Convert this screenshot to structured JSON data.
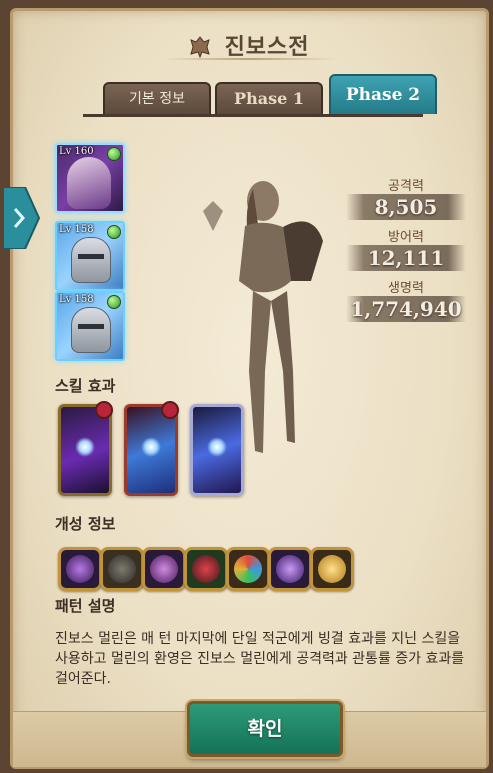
{
  "dialog": {
    "title": "진보스전"
  },
  "tabs": [
    {
      "label": "기본 정보",
      "active": false
    },
    {
      "label": "Phase 1",
      "active": false
    },
    {
      "label": "Phase 2",
      "active": true
    }
  ],
  "party": [
    {
      "level": "Lv 160"
    },
    {
      "level": "Lv 158"
    },
    {
      "level": "Lv 158"
    }
  ],
  "stats": {
    "attack_label": "공격력",
    "attack_value": "8,505",
    "defense_label": "방어력",
    "defense_value": "12,111",
    "hp_label": "생명력",
    "hp_value": "1,774,940"
  },
  "sections": {
    "skill_title": "스킬 효과",
    "trait_title": "개성 정보",
    "pattern_title": "패턴 설명"
  },
  "pattern_description": "진보스 멀린은 매 턴 마지막에 단일 적군에게 빙결 효과를 지닌 스킬을 사용하고 멀린의 환영은 진보스 멀린에게 공격력과 관통률 증가 효과를 걸어준다.",
  "confirm_button": "확인",
  "colors": {
    "active_tab": "#2f8f9d",
    "confirm": "#1f8a68"
  }
}
